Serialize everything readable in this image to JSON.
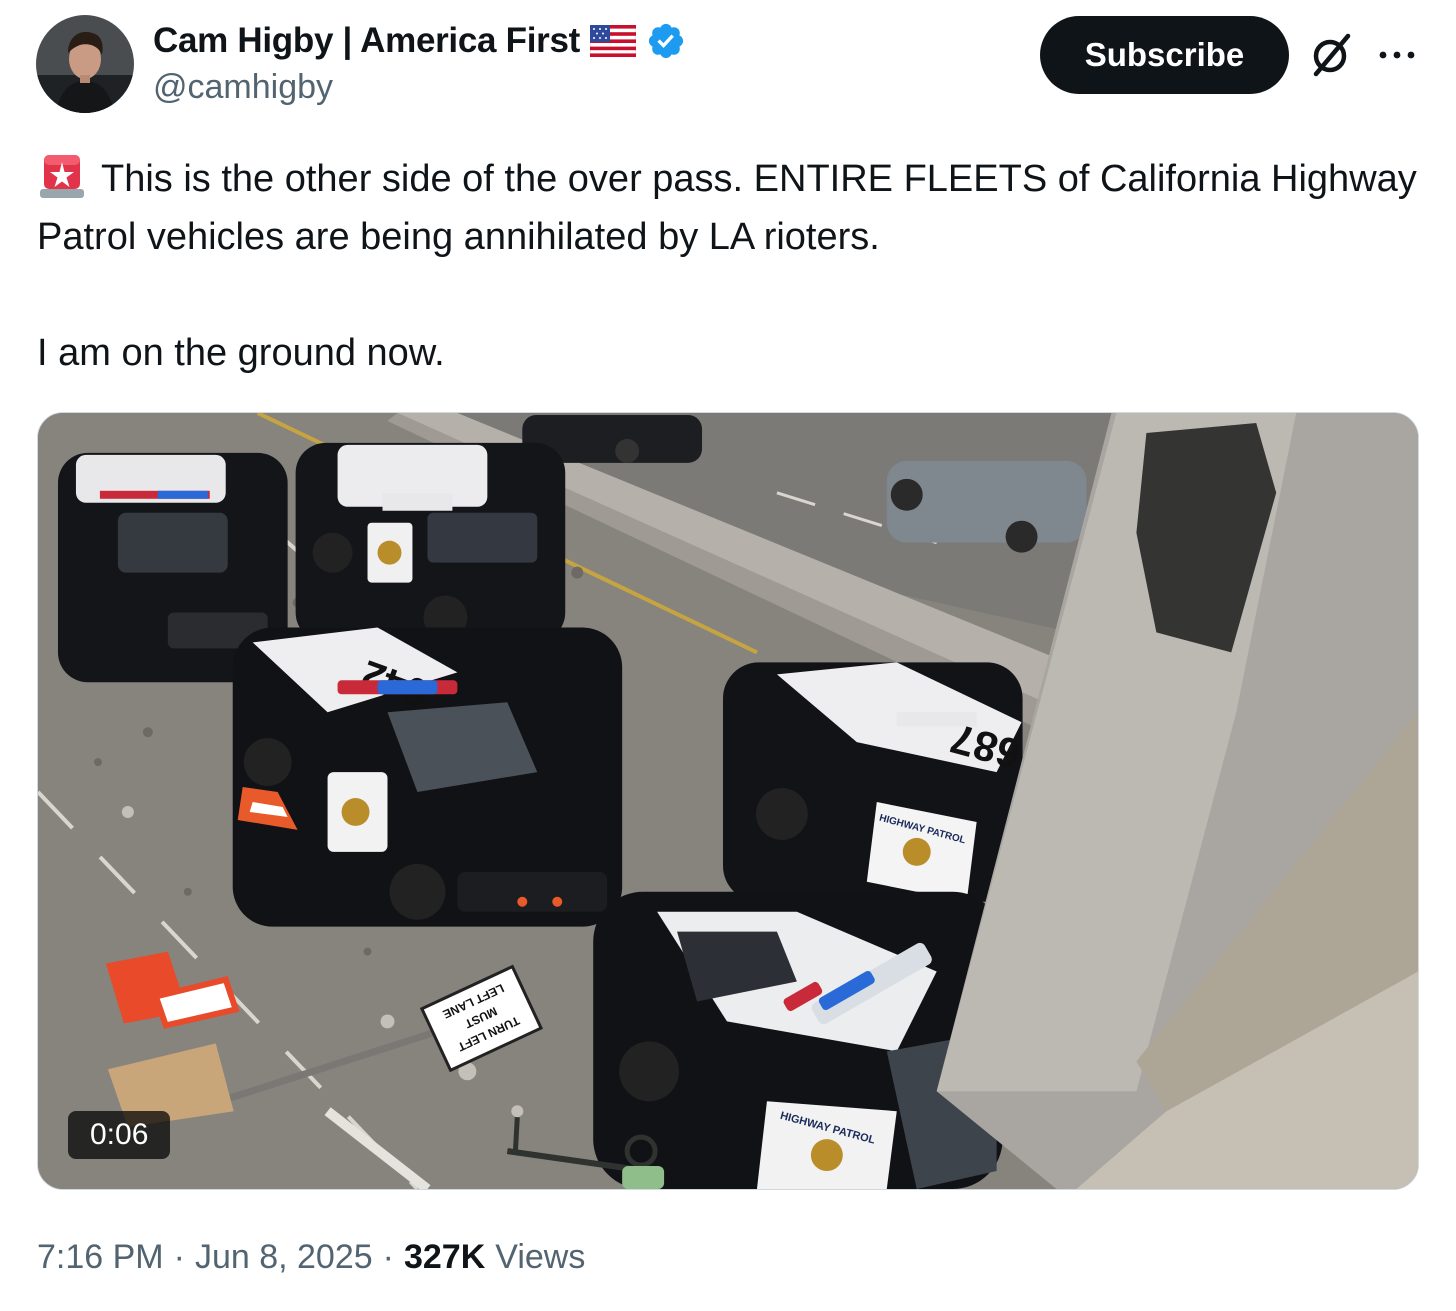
{
  "author": {
    "display_name": "Cam Higby | America First",
    "handle": "@camhigby"
  },
  "actions": {
    "subscribe_label": "Subscribe",
    "grok_icon": "grok-icon",
    "more_icon": "more-options-icon"
  },
  "tweet": {
    "lead_icon": "rotating-light-emoji",
    "paragraph_1": "This is the other side of the over pass. ENTIRE FLEETS of California Highway Patrol vehicles are being annihilated by LA rioters.",
    "paragraph_2": "I am on the ground now."
  },
  "media": {
    "type": "video",
    "duration": "0:06",
    "scene": {
      "unit_numbers": [
        "042",
        "687"
      ],
      "door_label": "HIGHWAY PATROL",
      "sign_lines": [
        "LEFT LANE",
        "MUST",
        "TURN LEFT"
      ]
    }
  },
  "footer": {
    "time": "7:16 PM",
    "separator": "·",
    "date": "Jun 8, 2025",
    "views_count": "327K",
    "views_label": "Views"
  },
  "colors": {
    "text_primary": "#0f1419",
    "text_secondary": "#536471",
    "verified_blue": "#1d9bf0",
    "button_bg": "#0f1419"
  }
}
